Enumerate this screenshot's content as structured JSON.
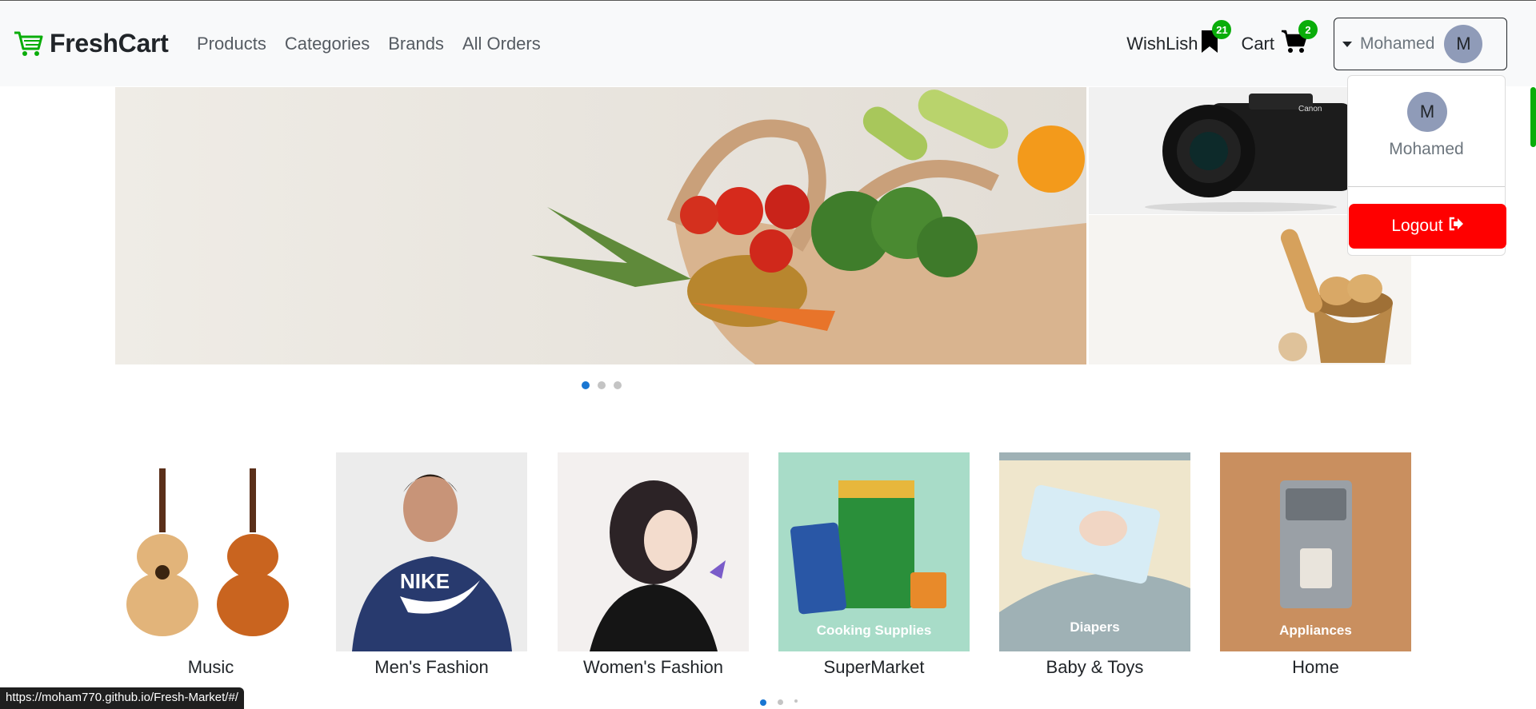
{
  "brand": {
    "name": "FreshCart",
    "icon": "cart-icon"
  },
  "nav": {
    "links": [
      "Products",
      "Categories",
      "Brands",
      "All Orders"
    ]
  },
  "wishlist": {
    "label": "WishLish",
    "count": "21",
    "icon": "bookmark-icon"
  },
  "cart": {
    "label": "Cart",
    "count": "2",
    "icon": "shopping-cart-icon"
  },
  "user": {
    "name": "Mohamed",
    "initial": "M"
  },
  "dropdown": {
    "name": "Mohamed",
    "initial": "M",
    "logout_label": "Logout",
    "logout_icon": "sign-out-icon"
  },
  "categories": [
    {
      "label": "Music",
      "overlay": ""
    },
    {
      "label": "Men's Fashion",
      "overlay": ""
    },
    {
      "label": "Women's Fashion",
      "overlay": ""
    },
    {
      "label": "SuperMarket",
      "overlay": "Cooking Supplies"
    },
    {
      "label": "Baby & Toys",
      "overlay": "Diapers"
    },
    {
      "label": "Home",
      "overlay": "Appliances"
    }
  ],
  "status_bar": {
    "url": "https://moham770.github.io/Fresh-Market/#/"
  },
  "colors": {
    "accent": "#0aad0a",
    "logout": "#ff0000",
    "avatar": "#8f9bb8",
    "active_dot": "#1976d2"
  }
}
